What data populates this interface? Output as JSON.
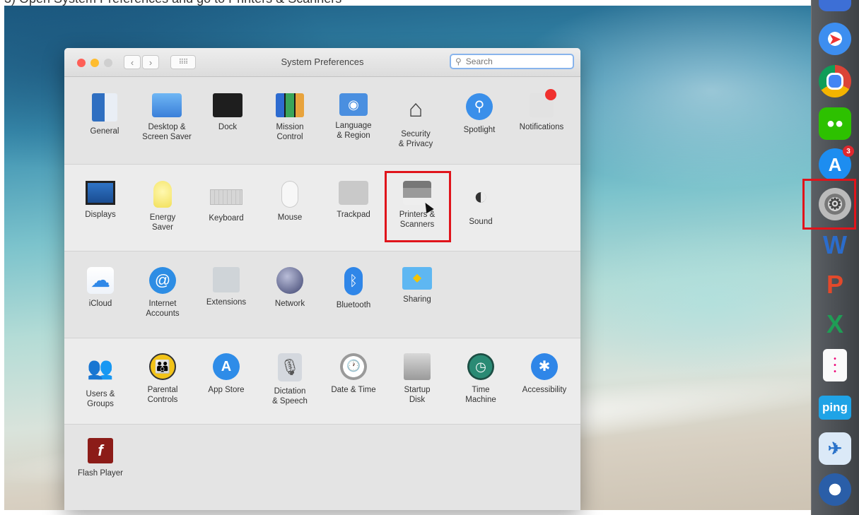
{
  "caption": "3) Open System Preferences and go to Printers & Scanners",
  "window": {
    "title": "System Preferences",
    "search_placeholder": "Search"
  },
  "colors": {
    "close": "#fe5f57",
    "minimize": "#febc2e",
    "zoom_inactive": "#cfcfcf",
    "highlight": "#e0141b"
  },
  "rows": [
    [
      {
        "label": "General",
        "icon": "general-icon"
      },
      {
        "label": "Desktop &\nScreen Saver",
        "icon": "desktop-screensaver-icon"
      },
      {
        "label": "Dock",
        "icon": "dock-icon"
      },
      {
        "label": "Mission\nControl",
        "icon": "mission-control-icon"
      },
      {
        "label": "Language\n& Region",
        "icon": "language-region-icon"
      },
      {
        "label": "Security\n& Privacy",
        "icon": "security-privacy-icon"
      },
      {
        "label": "Spotlight",
        "icon": "spotlight-icon"
      },
      {
        "label": "Notifications",
        "icon": "notifications-icon"
      }
    ],
    [
      {
        "label": "Displays",
        "icon": "displays-icon"
      },
      {
        "label": "Energy\nSaver",
        "icon": "energy-saver-icon"
      },
      {
        "label": "Keyboard",
        "icon": "keyboard-icon"
      },
      {
        "label": "Mouse",
        "icon": "mouse-icon"
      },
      {
        "label": "Trackpad",
        "icon": "trackpad-icon"
      },
      {
        "label": "Printers &\nScanners",
        "icon": "printer-icon"
      },
      {
        "label": "Sound",
        "icon": "sound-icon"
      }
    ],
    [
      {
        "label": "iCloud",
        "icon": "icloud-icon"
      },
      {
        "label": "Internet\nAccounts",
        "icon": "internet-accounts-icon"
      },
      {
        "label": "Extensions",
        "icon": "extensions-icon"
      },
      {
        "label": "Network",
        "icon": "network-icon"
      },
      {
        "label": "Bluetooth",
        "icon": "bluetooth-icon"
      },
      {
        "label": "Sharing",
        "icon": "sharing-icon"
      }
    ],
    [
      {
        "label": "Users &\nGroups",
        "icon": "users-groups-icon"
      },
      {
        "label": "Parental\nControls",
        "icon": "parental-controls-icon"
      },
      {
        "label": "App Store",
        "icon": "app-store-icon"
      },
      {
        "label": "Dictation\n& Speech",
        "icon": "dictation-speech-icon"
      },
      {
        "label": "Date & Time",
        "icon": "date-time-icon"
      },
      {
        "label": "Startup\nDisk",
        "icon": "startup-disk-icon"
      },
      {
        "label": "Time\nMachine",
        "icon": "time-machine-icon"
      },
      {
        "label": "Accessibility",
        "icon": "accessibility-icon"
      }
    ],
    [
      {
        "label": "Flash Player",
        "icon": "flash-player-icon"
      }
    ]
  ],
  "dock": {
    "items": [
      {
        "name": "safari-icon"
      },
      {
        "name": "chrome-icon"
      },
      {
        "name": "wechat-icon"
      },
      {
        "name": "app-store-icon",
        "badge": "3"
      },
      {
        "name": "system-preferences-icon"
      },
      {
        "name": "word-icon",
        "text": "W"
      },
      {
        "name": "powerpoint-icon",
        "text": "P"
      },
      {
        "name": "excel-icon",
        "text": "X"
      },
      {
        "name": "notes-icon"
      },
      {
        "name": "ping-icon",
        "text": "ping"
      },
      {
        "name": "bird-app-icon"
      },
      {
        "name": "quicktime-icon"
      }
    ]
  }
}
